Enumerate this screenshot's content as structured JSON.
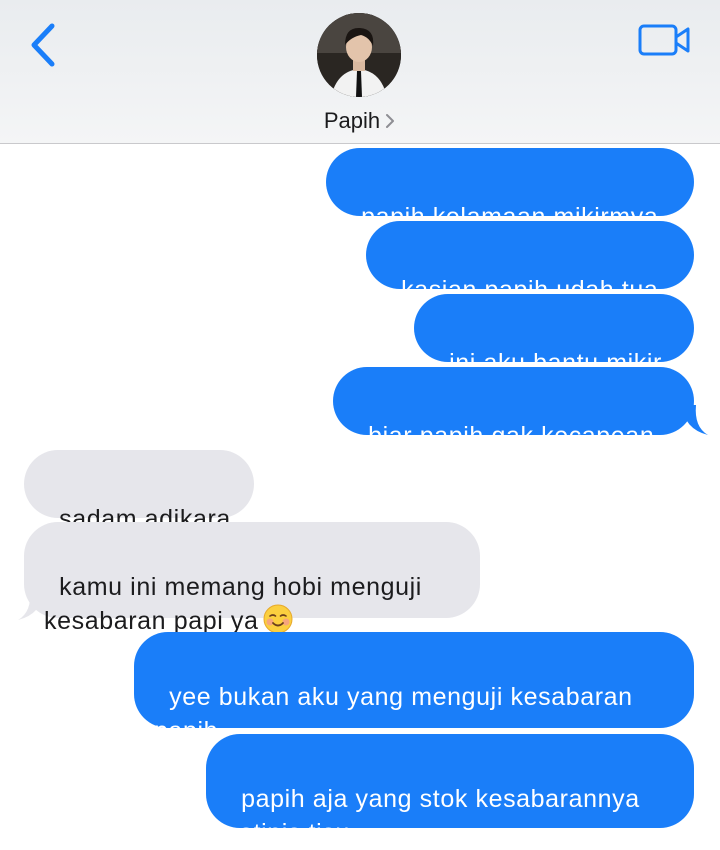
{
  "header": {
    "contact_name": "Papih",
    "back_icon": "chevron-left-icon",
    "video_icon": "video-camera-icon",
    "accent": "#1a7ef9"
  },
  "colors": {
    "sent_bubble": "#1a7ef9",
    "received_bubble": "#e6e6eb"
  },
  "messages": [
    {
      "from": "me",
      "text": "papih kelamaan mikirmya"
    },
    {
      "from": "me",
      "text": "kasian papih udah tua"
    },
    {
      "from": "me",
      "text": "ini aku bantu mikir"
    },
    {
      "from": "me",
      "text": "biar papih gak kecapean"
    },
    {
      "from": "them",
      "text": "sadam adikara"
    },
    {
      "from": "them",
      "text": "kamu ini memang hobi menguji\nkesabaran papi ya",
      "emoji": "smiling-face-icon"
    },
    {
      "from": "me",
      "text": "yee bukan aku yang menguji kesabaran\npapih"
    },
    {
      "from": "me",
      "text": "papih aja yang stok kesabarannya\nsetipis tisu"
    }
  ]
}
